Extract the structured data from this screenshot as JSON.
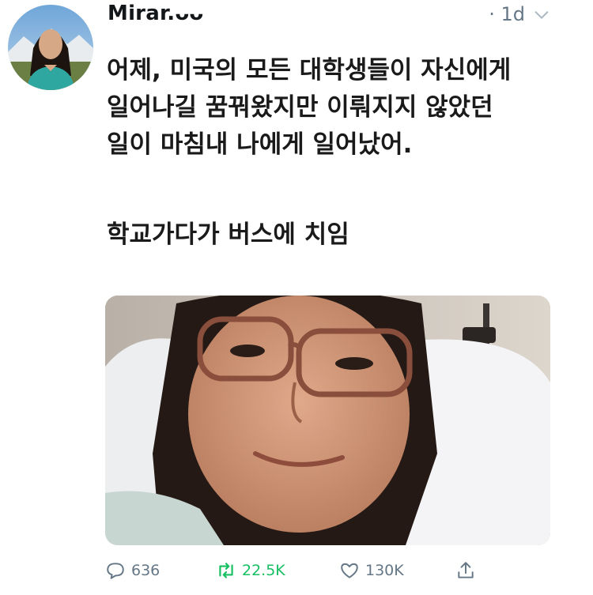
{
  "author": {
    "name": "Mirar.ᴗᴗ",
    "avatar_icon": "profile-photo-avatar"
  },
  "tweet": {
    "timestamp": "· 1d",
    "lines": [
      "어제, 미국의 모든 대학생들이 자신에게",
      "일어나길 꿈꿔왔지만 이뤄지지 않았던",
      "일이 마침내 나에게 일어났어."
    ],
    "line2": "학교가다가 버스에 치임",
    "media_icon": "hospital-selfie-photo"
  },
  "actions": {
    "reply": {
      "icon": "reply-icon",
      "count": "636"
    },
    "retweet": {
      "icon": "retweet-icon",
      "count": "22.5K",
      "color": "#17bf63"
    },
    "like": {
      "icon": "heart-icon",
      "count": "130K"
    },
    "share": {
      "icon": "share-icon"
    }
  },
  "colors": {
    "text": "#14171a",
    "muted": "#657786",
    "retweet": "#17bf63"
  }
}
